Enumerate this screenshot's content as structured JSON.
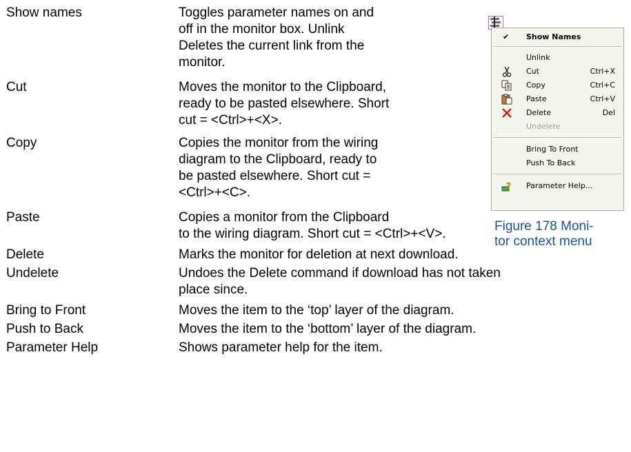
{
  "rows": [
    {
      "term": "Show names",
      "desc": [
        "Toggles parameter names on and",
        "off in the monitor box. Unlink",
        "Deletes the current link from the",
        "monitor."
      ]
    },
    {
      "term": "Cut",
      "desc": [
        "Moves the monitor to the Clipboard,",
        "ready to be pasted elsewhere. Short",
        "cut = <Ctrl>+<X>."
      ]
    },
    {
      "term": "Copy",
      "desc": [
        "Copies the monitor from the wiring",
        "diagram to the Clipboard, ready to",
        "be pasted elsewhere. Short cut =",
        "<Ctrl>+<C>."
      ]
    },
    {
      "term": "Paste",
      "desc": [
        "Copies a monitor from the Clipboard",
        "to the wiring diagram. Short cut = <Ctrl>+<V>."
      ]
    },
    {
      "term": "Delete",
      "desc": [
        "Marks the monitor for deletion at next download."
      ]
    },
    {
      "term": "Undelete",
      "desc": [
        "Undoes the Delete command if download has not taken",
        "place since."
      ]
    },
    {
      "term": "Bring to Front",
      "desc": [
        "Moves the item to the ‘top’ layer of the diagram."
      ]
    },
    {
      "term": "Push to Back",
      "desc": [
        "Moves the item to the ‘bottom’ layer of the diagram."
      ]
    },
    {
      "term": "Parameter Help",
      "desc": [
        "Shows parameter help for the item."
      ]
    }
  ],
  "menu": {
    "items": [
      {
        "label": "Show Names",
        "check": "✔",
        "shortcut": ""
      },
      {
        "label": "Unlink",
        "shortcut": ""
      },
      {
        "label": "Cut",
        "shortcut": "Ctrl+X",
        "icon": "scissors-icon"
      },
      {
        "label": "Copy",
        "shortcut": "Ctrl+C",
        "icon": "copy-icon"
      },
      {
        "label": "Paste",
        "shortcut": "Ctrl+V",
        "icon": "clipboard-icon"
      },
      {
        "label": "Delete",
        "shortcut": "Del",
        "icon": "delete-x-icon"
      },
      {
        "label": "Undelete",
        "shortcut": ""
      },
      {
        "label": "Bring To Front",
        "shortcut": ""
      },
      {
        "label": "Push To Back",
        "shortcut": ""
      },
      {
        "label": "Parameter Help...",
        "shortcut": "",
        "icon": "help-icon"
      }
    ]
  },
  "caption": [
    "Figure 178 Moni-",
    "tor context menu"
  ],
  "colors": {
    "caption": "#1d4f9a",
    "delete_icon": "#cc1b12"
  }
}
